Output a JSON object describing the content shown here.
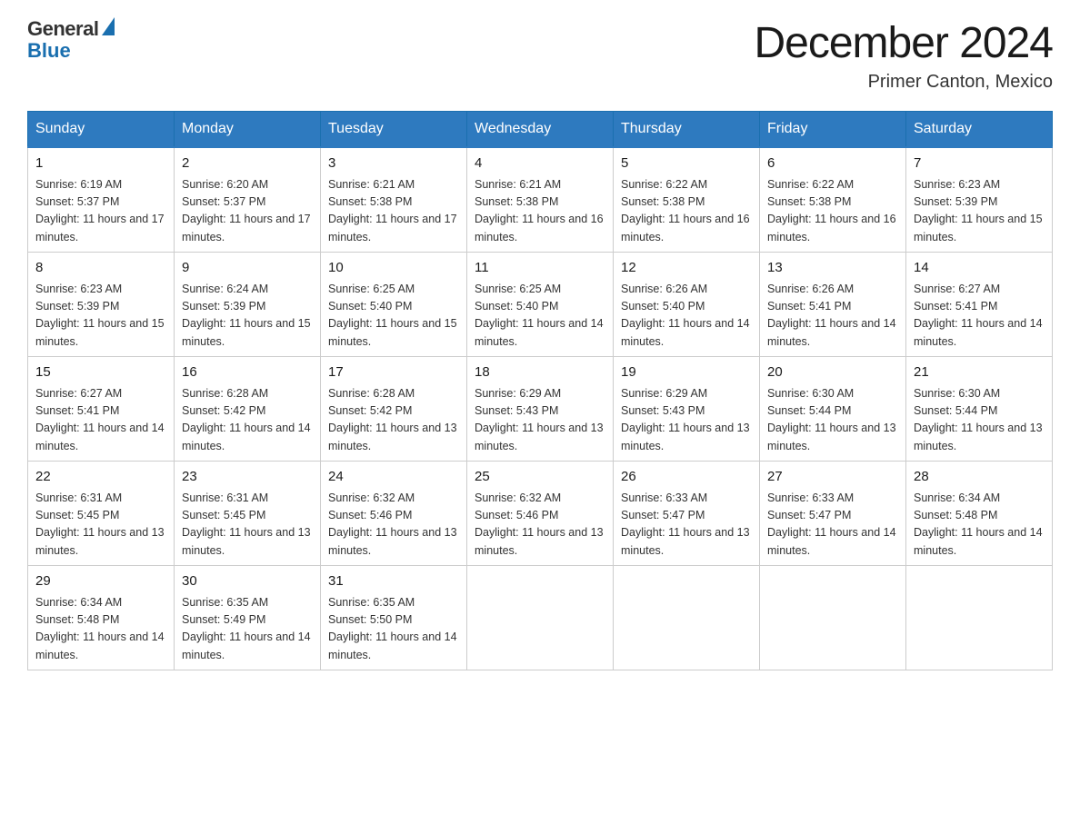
{
  "header": {
    "logo_general": "General",
    "logo_blue": "Blue",
    "month_title": "December 2024",
    "subtitle": "Primer Canton, Mexico"
  },
  "days_of_week": [
    "Sunday",
    "Monday",
    "Tuesday",
    "Wednesday",
    "Thursday",
    "Friday",
    "Saturday"
  ],
  "weeks": [
    [
      {
        "day": "1",
        "sunrise": "6:19 AM",
        "sunset": "5:37 PM",
        "daylight": "11 hours and 17 minutes."
      },
      {
        "day": "2",
        "sunrise": "6:20 AM",
        "sunset": "5:37 PM",
        "daylight": "11 hours and 17 minutes."
      },
      {
        "day": "3",
        "sunrise": "6:21 AM",
        "sunset": "5:38 PM",
        "daylight": "11 hours and 17 minutes."
      },
      {
        "day": "4",
        "sunrise": "6:21 AM",
        "sunset": "5:38 PM",
        "daylight": "11 hours and 16 minutes."
      },
      {
        "day": "5",
        "sunrise": "6:22 AM",
        "sunset": "5:38 PM",
        "daylight": "11 hours and 16 minutes."
      },
      {
        "day": "6",
        "sunrise": "6:22 AM",
        "sunset": "5:38 PM",
        "daylight": "11 hours and 16 minutes."
      },
      {
        "day": "7",
        "sunrise": "6:23 AM",
        "sunset": "5:39 PM",
        "daylight": "11 hours and 15 minutes."
      }
    ],
    [
      {
        "day": "8",
        "sunrise": "6:23 AM",
        "sunset": "5:39 PM",
        "daylight": "11 hours and 15 minutes."
      },
      {
        "day": "9",
        "sunrise": "6:24 AM",
        "sunset": "5:39 PM",
        "daylight": "11 hours and 15 minutes."
      },
      {
        "day": "10",
        "sunrise": "6:25 AM",
        "sunset": "5:40 PM",
        "daylight": "11 hours and 15 minutes."
      },
      {
        "day": "11",
        "sunrise": "6:25 AM",
        "sunset": "5:40 PM",
        "daylight": "11 hours and 14 minutes."
      },
      {
        "day": "12",
        "sunrise": "6:26 AM",
        "sunset": "5:40 PM",
        "daylight": "11 hours and 14 minutes."
      },
      {
        "day": "13",
        "sunrise": "6:26 AM",
        "sunset": "5:41 PM",
        "daylight": "11 hours and 14 minutes."
      },
      {
        "day": "14",
        "sunrise": "6:27 AM",
        "sunset": "5:41 PM",
        "daylight": "11 hours and 14 minutes."
      }
    ],
    [
      {
        "day": "15",
        "sunrise": "6:27 AM",
        "sunset": "5:41 PM",
        "daylight": "11 hours and 14 minutes."
      },
      {
        "day": "16",
        "sunrise": "6:28 AM",
        "sunset": "5:42 PM",
        "daylight": "11 hours and 14 minutes."
      },
      {
        "day": "17",
        "sunrise": "6:28 AM",
        "sunset": "5:42 PM",
        "daylight": "11 hours and 13 minutes."
      },
      {
        "day": "18",
        "sunrise": "6:29 AM",
        "sunset": "5:43 PM",
        "daylight": "11 hours and 13 minutes."
      },
      {
        "day": "19",
        "sunrise": "6:29 AM",
        "sunset": "5:43 PM",
        "daylight": "11 hours and 13 minutes."
      },
      {
        "day": "20",
        "sunrise": "6:30 AM",
        "sunset": "5:44 PM",
        "daylight": "11 hours and 13 minutes."
      },
      {
        "day": "21",
        "sunrise": "6:30 AM",
        "sunset": "5:44 PM",
        "daylight": "11 hours and 13 minutes."
      }
    ],
    [
      {
        "day": "22",
        "sunrise": "6:31 AM",
        "sunset": "5:45 PM",
        "daylight": "11 hours and 13 minutes."
      },
      {
        "day": "23",
        "sunrise": "6:31 AM",
        "sunset": "5:45 PM",
        "daylight": "11 hours and 13 minutes."
      },
      {
        "day": "24",
        "sunrise": "6:32 AM",
        "sunset": "5:46 PM",
        "daylight": "11 hours and 13 minutes."
      },
      {
        "day": "25",
        "sunrise": "6:32 AM",
        "sunset": "5:46 PM",
        "daylight": "11 hours and 13 minutes."
      },
      {
        "day": "26",
        "sunrise": "6:33 AM",
        "sunset": "5:47 PM",
        "daylight": "11 hours and 13 minutes."
      },
      {
        "day": "27",
        "sunrise": "6:33 AM",
        "sunset": "5:47 PM",
        "daylight": "11 hours and 14 minutes."
      },
      {
        "day": "28",
        "sunrise": "6:34 AM",
        "sunset": "5:48 PM",
        "daylight": "11 hours and 14 minutes."
      }
    ],
    [
      {
        "day": "29",
        "sunrise": "6:34 AM",
        "sunset": "5:48 PM",
        "daylight": "11 hours and 14 minutes."
      },
      {
        "day": "30",
        "sunrise": "6:35 AM",
        "sunset": "5:49 PM",
        "daylight": "11 hours and 14 minutes."
      },
      {
        "day": "31",
        "sunrise": "6:35 AM",
        "sunset": "5:50 PM",
        "daylight": "11 hours and 14 minutes."
      },
      null,
      null,
      null,
      null
    ]
  ],
  "labels": {
    "sunrise": "Sunrise:",
    "sunset": "Sunset:",
    "daylight": "Daylight:"
  }
}
